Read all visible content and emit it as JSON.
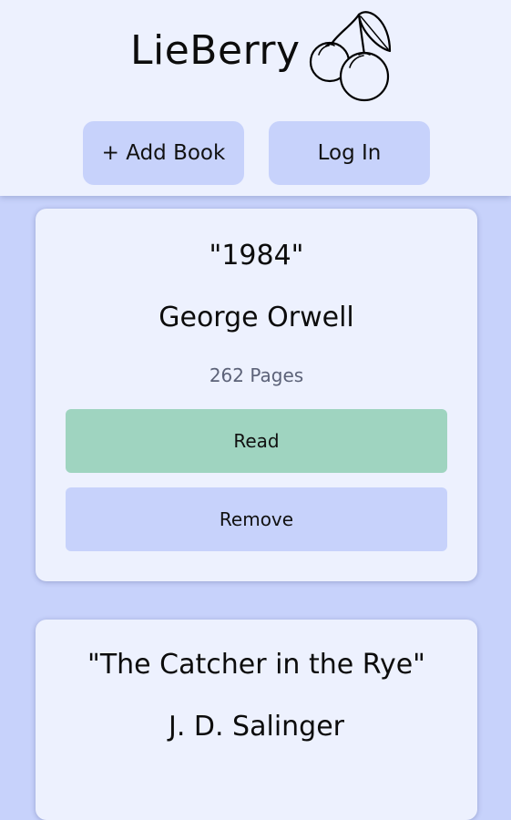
{
  "app": {
    "title": "LieBerry",
    "logo_icon": "cherries-icon"
  },
  "header": {
    "add_book_label": "+ Add Book",
    "login_label": "Log In"
  },
  "books": [
    {
      "title": "\"1984\"",
      "author": "George Orwell",
      "pages": "262 Pages",
      "read_label": "Read",
      "remove_label": "Remove"
    },
    {
      "title": "\"The Catcher in the Rye\"",
      "author": "J. D. Salinger"
    }
  ],
  "colors": {
    "background": "#c7d2fb",
    "surface": "#edf1fe",
    "read_button": "#9fd4c0",
    "secondary_button": "#c7d2fb",
    "muted_text": "#5c6278"
  }
}
